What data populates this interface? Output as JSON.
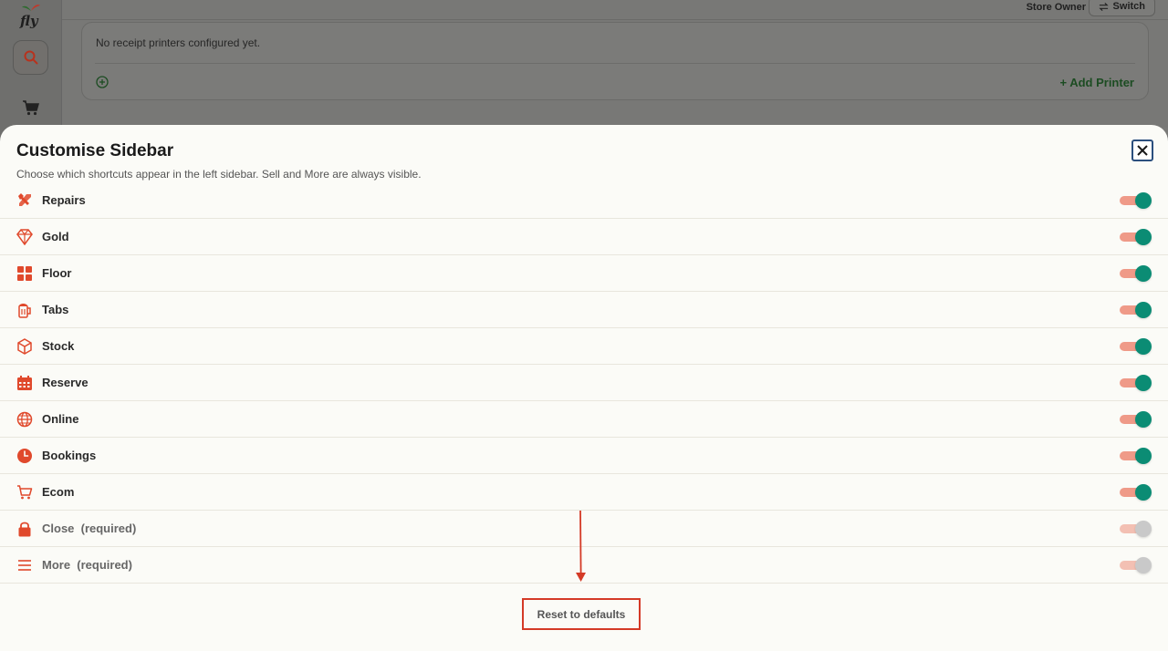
{
  "app": {
    "logo_text": "fly"
  },
  "header": {
    "role": "Store Owner",
    "switch_label": "Switch"
  },
  "printers": {
    "empty_text": "No receipt printers configured yet.",
    "add_label": "+ Add Printer"
  },
  "sheet": {
    "title": "Customise Sidebar",
    "subtitle": "Choose which shortcuts appear in the left sidebar. Sell and More are always visible.",
    "items": [
      {
        "label": "Repairs",
        "icon": "wrench-icon",
        "enabled": true,
        "required": false
      },
      {
        "label": "Gold",
        "icon": "diamond-icon",
        "enabled": true,
        "required": false
      },
      {
        "label": "Floor",
        "icon": "grid-icon",
        "enabled": true,
        "required": false
      },
      {
        "label": "Tabs",
        "icon": "beer-mug-icon",
        "enabled": true,
        "required": false
      },
      {
        "label": "Stock",
        "icon": "box-icon",
        "enabled": true,
        "required": false
      },
      {
        "label": "Reserve",
        "icon": "calendar-icon",
        "enabled": true,
        "required": false
      },
      {
        "label": "Online",
        "icon": "globe-icon",
        "enabled": true,
        "required": false
      },
      {
        "label": "Bookings",
        "icon": "clock-icon",
        "enabled": true,
        "required": false
      },
      {
        "label": "Ecom",
        "icon": "cart-icon",
        "enabled": true,
        "required": false
      },
      {
        "label": "Close  (required)",
        "icon": "lock-icon",
        "enabled": true,
        "required": true
      },
      {
        "label": "More  (required)",
        "icon": "menu-icon",
        "enabled": true,
        "required": true
      }
    ],
    "reset_label": "Reset to defaults"
  },
  "colors": {
    "accent": "#e0492c",
    "toggle_on": "#0b8c74",
    "highlight": "#d43a26"
  }
}
